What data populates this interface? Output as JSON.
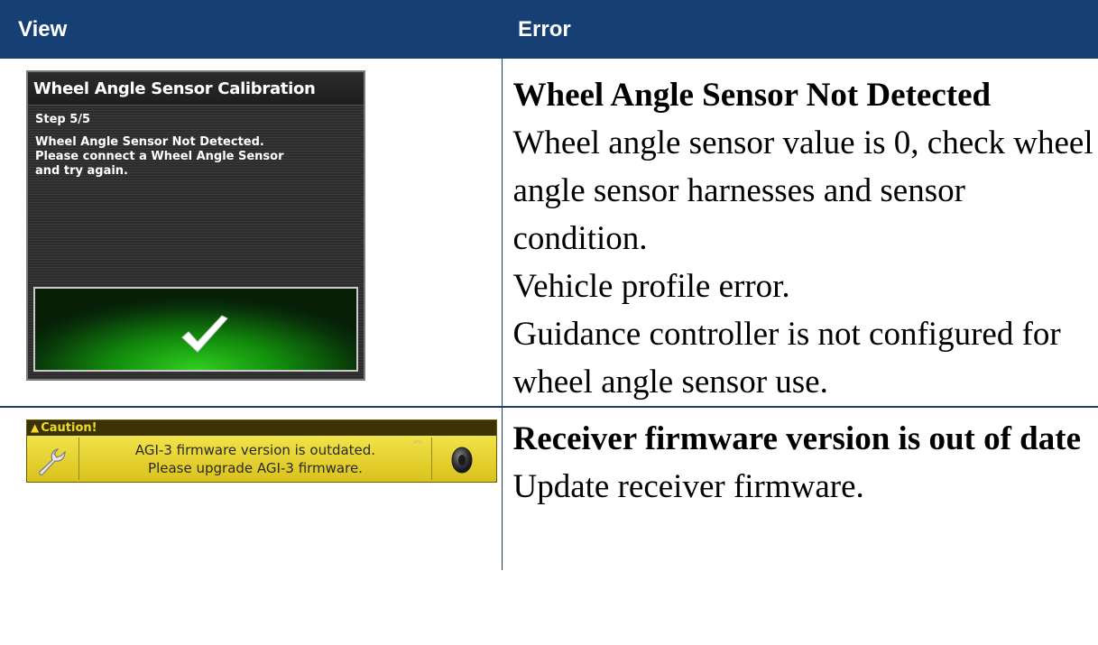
{
  "header": {
    "view_label": "View",
    "error_label": "Error"
  },
  "rows": [
    {
      "view": {
        "title": "Wheel Angle Sensor Calibration",
        "step": "Step 5/5",
        "message_lines": [
          "Wheel Angle Sensor Not Detected.",
          "Please connect a Wheel Angle Sensor",
          "and try again."
        ],
        "confirm_icon": "checkmark-icon",
        "confirm_color": "#1fa514"
      },
      "error": {
        "title": "Wheel Angle Sensor Not Detected",
        "lines": [
          "Wheel angle sensor value is 0, check wheel angle sensor harnesses and sensor condition.",
          "Vehicle profile error.",
          "Guidance controller is not configured for wheel angle sensor use."
        ]
      }
    },
    {
      "view": {
        "caution_label": "Caution!",
        "message_lines": [
          "AGI-3 firmware version is outdated.",
          "Please upgrade AGI-3 firmware."
        ],
        "left_icon": "wrench-icon",
        "right_icon": "speaker-icon",
        "banner_color": "#e8d63a"
      },
      "error": {
        "title": "Receiver firmware version is out of date",
        "lines": [
          "Update receiver firmware."
        ]
      }
    }
  ]
}
